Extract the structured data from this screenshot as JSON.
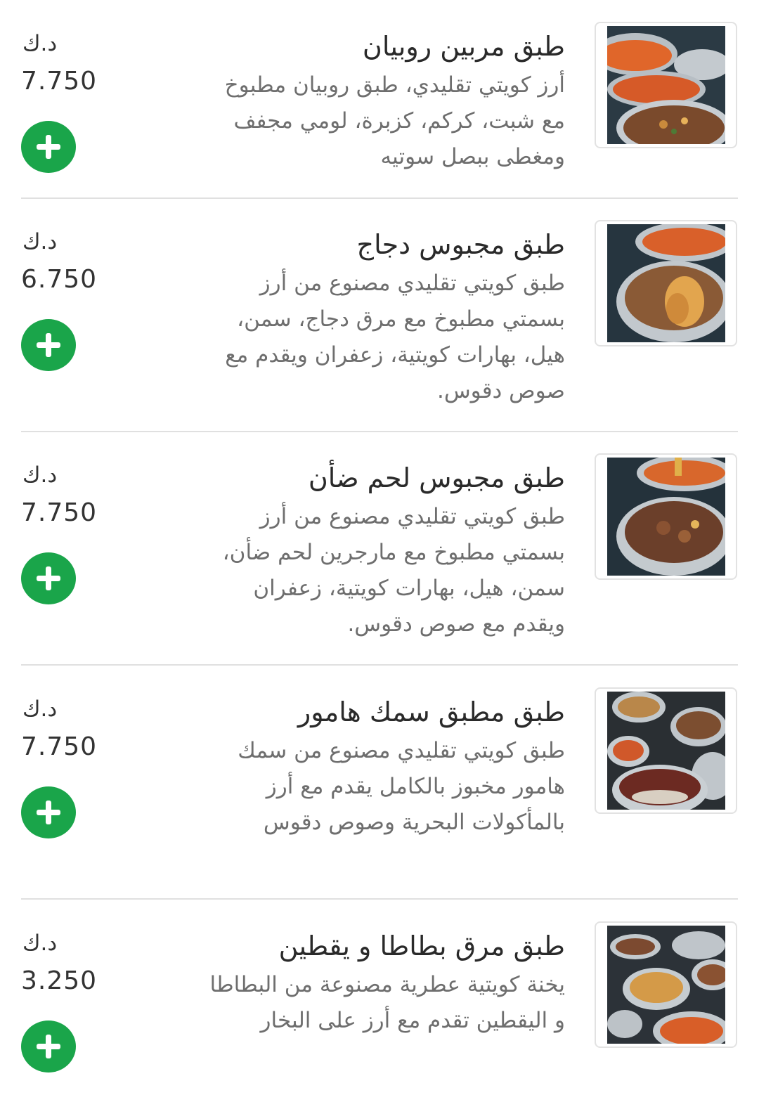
{
  "colors": {
    "add_button": "#1aa54a",
    "title_text": "#2a2a2a",
    "description_text": "#6e6e6e",
    "divider": "#e0e0e0"
  },
  "items": [
    {
      "title": "طبق مربين روبيان",
      "description": "أرز كويتي تقليدي، طبق روبيان مطبوخ مع شبت، كركم، كزبرة، لومي مجفف ومغطى ببصل سوتيه",
      "currency": "د.ك",
      "price": "7.750",
      "image_icon": "shrimp-rice-dish-icon",
      "add_icon": "plus-icon"
    },
    {
      "title": "طبق مجبوس دجاج",
      "description": "طبق كويتي تقليدي مصنوع من أرز بسمتي مطبوخ مع مرق دجاج، سمن، هيل، بهارات كويتية، زعفران ويقدم مع صوص دقوس.",
      "currency": "د.ك",
      "price": "6.750",
      "image_icon": "chicken-machboos-dish-icon",
      "add_icon": "plus-icon"
    },
    {
      "title": "طبق مجبوس لحم ضأن",
      "description": "طبق كويتي تقليدي مصنوع من أرز بسمتي مطبوخ مع مارجرين لحم ضأن، سمن، هيل، بهارات كويتية، زعفران ويقدم مع صوص دقوس.",
      "currency": "د.ك",
      "price": "7.750",
      "image_icon": "lamb-machboos-dish-icon",
      "add_icon": "plus-icon"
    },
    {
      "title": "طبق مطبق سمك هامور",
      "description": "طبق كويتي تقليدي مصنوع من سمك هامور مخبوز بالكامل يقدم مع أرز بالمأكولات البحرية وصوص دقوس",
      "currency": "د.ك",
      "price": "7.750",
      "image_icon": "hamour-fish-dish-icon",
      "add_icon": "plus-icon"
    },
    {
      "title": "طبق مرق بطاطا و يقطين",
      "description": "يخنة كويتية عطرية مصنوعة من البطاطا و اليقطين تقدم مع أرز على البخار",
      "currency": "د.ك",
      "price": "3.250",
      "image_icon": "potato-pumpkin-stew-icon",
      "add_icon": "plus-icon"
    }
  ]
}
